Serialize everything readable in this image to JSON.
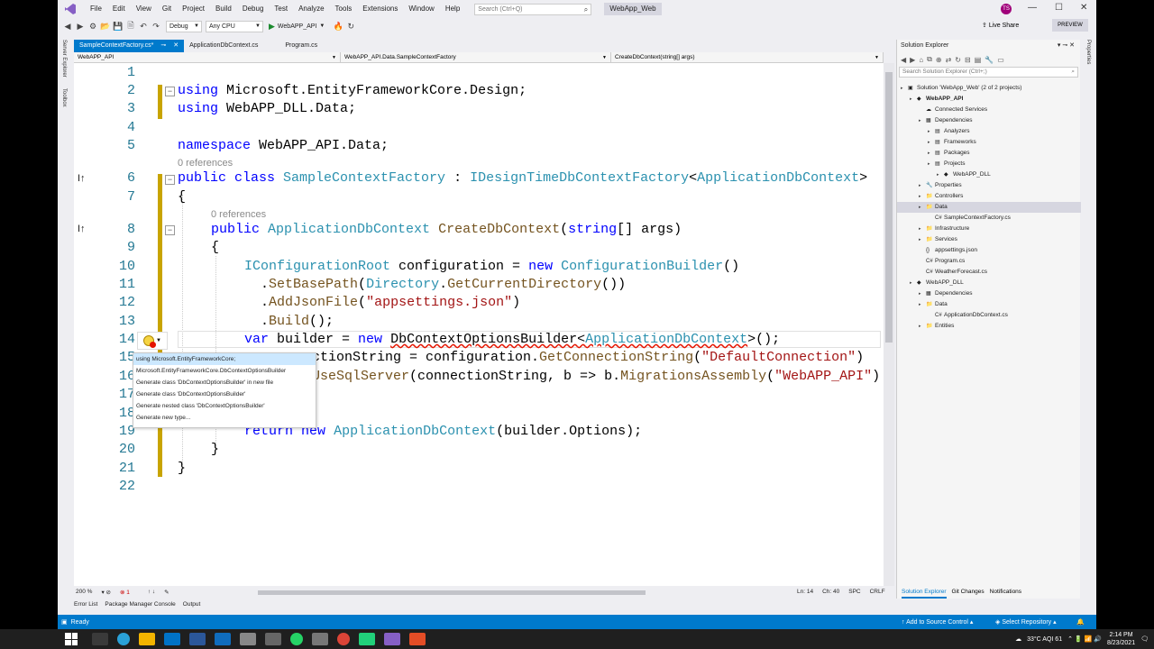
{
  "menu": {
    "items": [
      "File",
      "Edit",
      "View",
      "Git",
      "Project",
      "Build",
      "Debug",
      "Test",
      "Analyze",
      "Tools",
      "Extensions",
      "Window",
      "Help"
    ],
    "search_placeholder": "Search (Ctrl+Q)",
    "solution_title": "WebApp_Web",
    "avatar": "TS"
  },
  "toolbar": {
    "config": "Debug",
    "platform": "Any CPU",
    "run_target": "WebAPP_API",
    "live_share": "Live Share",
    "preview": "PREVIEW"
  },
  "left_strip": [
    "Server Explorer",
    "Toolbox"
  ],
  "tabs": [
    {
      "label": "SampleContextFactory.cs*"
    },
    {
      "label": "ApplicationDbContext.cs"
    },
    {
      "label": "Program.cs"
    }
  ],
  "navbar": {
    "project": "WebAPP_API",
    "type": "WebAPP_API.Data.SampleContextFactory",
    "member": "CreateDbContext(string[] args)"
  },
  "code": {
    "line_numbers": [
      "1",
      "2",
      "3",
      "4",
      "5",
      "6",
      "7",
      "8",
      "9",
      "10",
      "11",
      "12",
      "13",
      "14",
      "15",
      "16",
      "17",
      "18",
      "19",
      "20",
      "21",
      "22"
    ],
    "refs_class": "0 references",
    "refs_method": "0 references",
    "l2_kw": "using",
    "l2_rest": " Microsoft.EntityFrameworkCore.Design;",
    "l3_kw": "using",
    "l3_rest": " WebAPP_DLL.Data;",
    "l5_kw": "namespace",
    "l5_rest": " WebAPP_API.Data;",
    "l6_kw1": "public",
    "l6_kw2": " class ",
    "l6_name": "SampleContextFactory",
    "l6_colon": " : ",
    "l6_iface": "IDesignTimeDbContextFactory",
    "l6_lt": "<",
    "l6_gen": "ApplicationDbContext",
    "l6_gt": ">",
    "l7": "{",
    "l8_kw": "public",
    "l8_type": "ApplicationDbContext",
    "l8_method": "CreateDbContext",
    "l8_p1": "(",
    "l8_kwstr": "string",
    "l8_rest": "[] args)",
    "l9": "{",
    "l10_type": "IConfigurationRoot",
    "l10_mid": " configuration = ",
    "l10_new": "new",
    "l10_type2": "ConfigurationBuilder",
    "l10_end": "()",
    "l11_dot": ".",
    "l11_m": "SetBasePath",
    "l11_p": "(",
    "l11_t": "Directory",
    "l11_dot2": ".",
    "l11_m2": "GetCurrentDirectory",
    "l11_end": "())",
    "l12_dot": ".",
    "l12_m": "AddJsonFile",
    "l12_p": "(",
    "l12_s": "\"appsettings.json\"",
    "l12_end": ")",
    "l13_dot": ".",
    "l13_m": "Build",
    "l13_end": "();",
    "l14_kw": "var",
    "l14_mid": " builder = ",
    "l14_new": "new",
    "l14_sq": "DbContextOptionsBuilder",
    "l14_lt": "<",
    "l14_gen": "ApplicationDbContext",
    "l14_end": ">();",
    "l15_a": "ctionString = configuration.",
    "l15_m": "GetConnectionString",
    "l15_p": "(",
    "l15_s": "\"DefaultConnection\"",
    "l15_end": ")",
    "l16_a": "UseSqlServer",
    "l16_b": "(connectionString, b => b.",
    "l16_m": "MigrationsAssembly",
    "l16_p": "(",
    "l16_s": "\"WebAPP_API\"",
    "l16_end": ")",
    "l19_kw": "return",
    "l19_new": "new",
    "l19_type": "ApplicationDbContext",
    "l19_end": "(builder.Options);",
    "l20": "}",
    "l21": "}"
  },
  "quick_actions": [
    "using Microsoft.EntityFrameworkCore;",
    "Microsoft.EntityFrameworkCore.DbContextOptionsBuilder",
    "Generate class 'DbContextOptionsBuilder' in new file",
    "Generate class 'DbContextOptionsBuilder'",
    "Generate nested class 'DbContextOptionsBuilder'",
    "Generate new type..."
  ],
  "editor_status": {
    "zoom": "200 %",
    "errors": "1",
    "line": "Ln: 14",
    "col": "Ch: 40",
    "spc": "SPC",
    "crlf": "CRLF"
  },
  "bottom_tabs": [
    "Error List",
    "Package Manager Console",
    "Output"
  ],
  "status_bar": {
    "ready": "Ready",
    "source_control": "Add to Source Control",
    "repo": "Select Repository"
  },
  "solution_explorer": {
    "title": "Solution Explorer",
    "search_placeholder": "Search Solution Explorer (Ctrl+;)",
    "tree": [
      {
        "label": "Solution 'WebApp_Web' (2 of 2 projects)",
        "indent": 0
      },
      {
        "label": "WebAPP_API",
        "indent": 1,
        "bold": true
      },
      {
        "label": "Connected Services",
        "indent": 2
      },
      {
        "label": "Dependencies",
        "indent": 2
      },
      {
        "label": "Analyzers",
        "indent": 3
      },
      {
        "label": "Frameworks",
        "indent": 3
      },
      {
        "label": "Packages",
        "indent": 3
      },
      {
        "label": "Projects",
        "indent": 3
      },
      {
        "label": "WebAPP_DLL",
        "indent": 4
      },
      {
        "label": "Properties",
        "indent": 2
      },
      {
        "label": "Controllers",
        "indent": 2
      },
      {
        "label": "Data",
        "indent": 2,
        "selected": true
      },
      {
        "label": "SampleContextFactory.cs",
        "indent": 3
      },
      {
        "label": "Infrastructure",
        "indent": 2
      },
      {
        "label": "Services",
        "indent": 2
      },
      {
        "label": "appsettings.json",
        "indent": 2
      },
      {
        "label": "Program.cs",
        "indent": 2
      },
      {
        "label": "WeatherForecast.cs",
        "indent": 2
      },
      {
        "label": "WebAPP_DLL",
        "indent": 1
      },
      {
        "label": "Dependencies",
        "indent": 2
      },
      {
        "label": "Data",
        "indent": 2
      },
      {
        "label": "ApplicationDbContext.cs",
        "indent": 3
      },
      {
        "label": "Entities",
        "indent": 2
      }
    ],
    "bottom_tabs": [
      "Solution Explorer",
      "Git Changes",
      "Notifications"
    ]
  },
  "right_strip": "Properties",
  "taskbar": {
    "weather": "33°C  AQI 61",
    "time": "2:14 PM",
    "date": "8/23/2021"
  },
  "colors": {
    "accent": "#007acc",
    "keyword": "#0000ff",
    "type": "#2b91af",
    "string": "#a31515"
  }
}
